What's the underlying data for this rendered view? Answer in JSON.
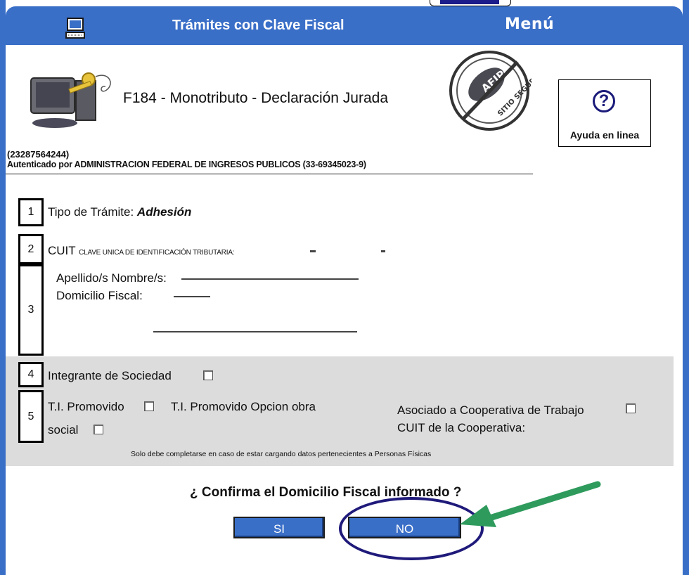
{
  "header": {
    "title": "Trámites con Clave Fiscal",
    "menu_label": "Menú"
  },
  "form": {
    "title": "F184 - Monotributo - Declaración Jurada",
    "user_cuit": "(23287564244)",
    "authenticated_by": "Autenticado por ADMINISTRACION FEDERAL DE INGRESOS PUBLICOS (33-69345023-9)"
  },
  "help": {
    "label": "Ayuda en linea",
    "symbol": "?"
  },
  "seal": {
    "text_top": "AFIP",
    "text_bottom": "SITIO SEGURO"
  },
  "rows": {
    "r1": {
      "num": "1",
      "label": "Tipo de Trámite: ",
      "value": "Adhesión"
    },
    "r2": {
      "num": "2",
      "label": "CUIT",
      "sub": "CLAVE UNICA DE IDENTIFICACIÓN TRIBUTARIA:"
    },
    "r3": {
      "num": "3",
      "name_label": "Apellido/s Nombre/s:",
      "address_label": "Domicilio Fiscal:"
    },
    "r4": {
      "num": "4",
      "label": "Integrante de Sociedad"
    },
    "r5": {
      "num": "5",
      "ti_promovido": "T.I. Promovido",
      "ti_promovido_opcion": "T.I. Promovido Opcion obra",
      "social": "social",
      "asociado": "Asociado a Cooperativa de Trabajo",
      "cuit_coop": "CUIT de la Cooperativa:"
    }
  },
  "note": "Solo debe completarse en caso de estar cargando datos pertenecientes a Personas Físicas",
  "confirm": {
    "question": "¿ Confirma el Domicilio Fiscal informado ?",
    "yes_label": "SI",
    "no_label": "NO"
  },
  "colors": {
    "header_blue": "#3a6fc8",
    "annotation_navy": "#1f1a7a",
    "annotation_green": "#2e9a5c"
  }
}
